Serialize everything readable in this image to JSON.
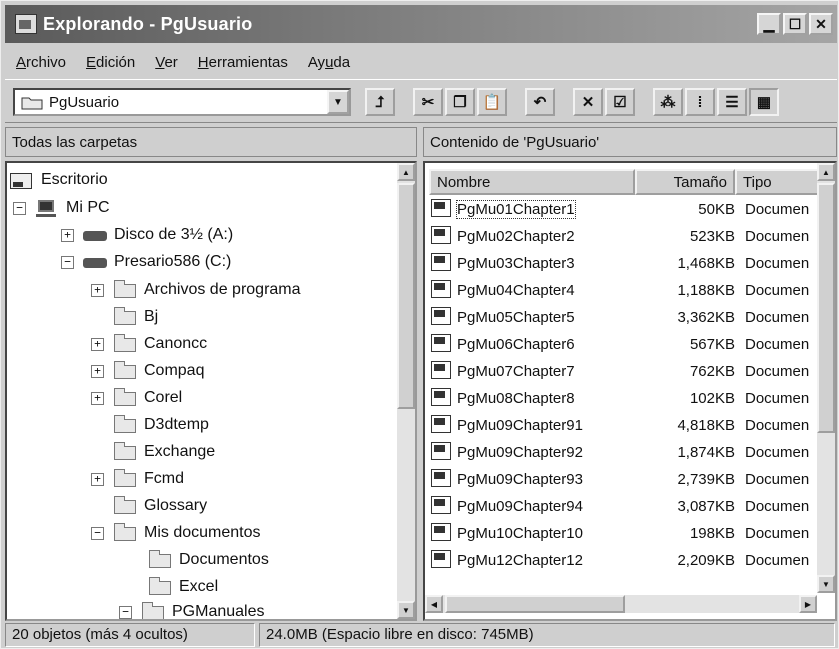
{
  "window": {
    "title": "Explorando - PgUsuario"
  },
  "menu": [
    {
      "label_under": "A",
      "label_rest": "rchivo"
    },
    {
      "label_under": "E",
      "label_rest": "dición"
    },
    {
      "label_under": "V",
      "label_rest": "er"
    },
    {
      "label_under": "H",
      "label_rest": "erramientas"
    },
    {
      "label_pre": "Ay",
      "label_under": "u",
      "label_rest": "da"
    }
  ],
  "address": {
    "value": "PgUsuario"
  },
  "left_header": "Todas las carpetas",
  "right_header": "Contenido de 'PgUsuario'",
  "tree": [
    {
      "label": "Escritorio",
      "icon": "desktop-icon"
    },
    {
      "label": "Mi PC",
      "icon": "computer-icon",
      "exp": "−"
    },
    {
      "label": "Disco de 3½ (A:)",
      "icon": "floppy-drive-icon",
      "exp": "+"
    },
    {
      "label": "Presario586 (C:)",
      "icon": "hard-drive-icon",
      "exp": "−"
    },
    {
      "label": "Archivos de programa",
      "icon": "folder-icon",
      "exp": "+"
    },
    {
      "label": "Bj",
      "icon": "folder-icon"
    },
    {
      "label": "Canoncc",
      "icon": "folder-icon",
      "exp": "+"
    },
    {
      "label": "Compaq",
      "icon": "folder-icon",
      "exp": "+"
    },
    {
      "label": "Corel",
      "icon": "folder-icon",
      "exp": "+"
    },
    {
      "label": "D3dtemp",
      "icon": "folder-icon"
    },
    {
      "label": "Exchange",
      "icon": "folder-icon"
    },
    {
      "label": "Fcmd",
      "icon": "folder-icon",
      "exp": "+"
    },
    {
      "label": "Glossary",
      "icon": "folder-icon"
    },
    {
      "label": "Mis documentos",
      "icon": "folder-icon",
      "exp": "−"
    },
    {
      "label": "Documentos",
      "icon": "folder-icon"
    },
    {
      "label": "Excel",
      "icon": "folder-icon"
    },
    {
      "label": "PGManuales",
      "icon": "folder-icon",
      "exp": "−"
    }
  ],
  "columns": {
    "name": "Nombre",
    "size": "Tamaño",
    "type": "Tipo"
  },
  "files": [
    {
      "name": "PgMu01Chapter1",
      "size": "50KB",
      "type": "Documen"
    },
    {
      "name": "PgMu02Chapter2",
      "size": "523KB",
      "type": "Documen"
    },
    {
      "name": "PgMu03Chapter3",
      "size": "1,468KB",
      "type": "Documen"
    },
    {
      "name": "PgMu04Chapter4",
      "size": "1,188KB",
      "type": "Documen"
    },
    {
      "name": "PgMu05Chapter5",
      "size": "3,362KB",
      "type": "Documen"
    },
    {
      "name": "PgMu06Chapter6",
      "size": "567KB",
      "type": "Documen"
    },
    {
      "name": "PgMu07Chapter7",
      "size": "762KB",
      "type": "Documen"
    },
    {
      "name": "PgMu08Chapter8",
      "size": "102KB",
      "type": "Documen"
    },
    {
      "name": "PgMu09Chapter91",
      "size": "4,818KB",
      "type": "Documen"
    },
    {
      "name": "PgMu09Chapter92",
      "size": "1,874KB",
      "type": "Documen"
    },
    {
      "name": "PgMu09Chapter93",
      "size": "2,739KB",
      "type": "Documen"
    },
    {
      "name": "PgMu09Chapter94",
      "size": "3,087KB",
      "type": "Documen"
    },
    {
      "name": "PgMu10Chapter10",
      "size": "198KB",
      "type": "Documen"
    },
    {
      "name": "PgMu12Chapter12",
      "size": "2,209KB",
      "type": "Documen"
    }
  ],
  "status": {
    "objects": "20 objetos (más 4 ocultos)",
    "space": "24.0MB (Espacio libre en disco: 745MB)"
  }
}
